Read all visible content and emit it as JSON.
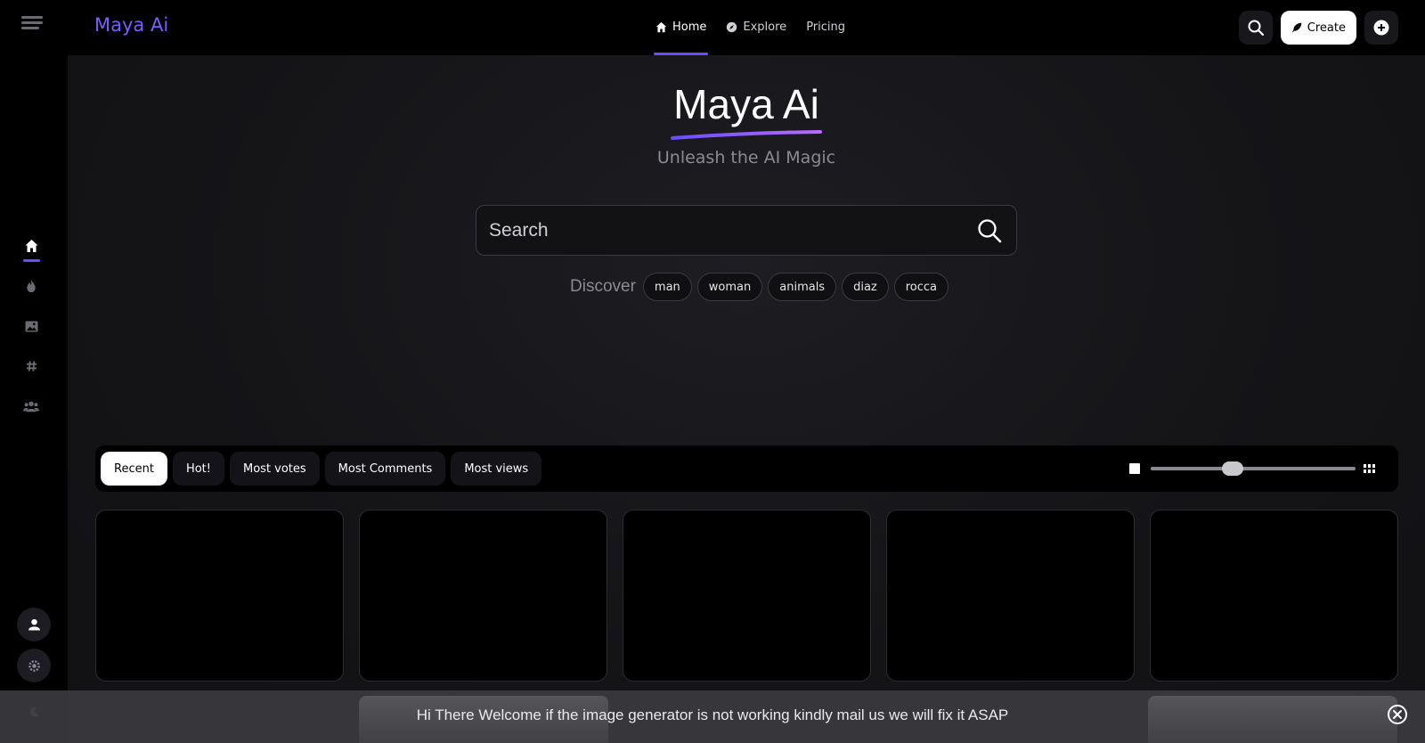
{
  "brand": "Maya Ai",
  "nav": [
    {
      "label": "Home",
      "icon": "home-icon",
      "active": true
    },
    {
      "label": "Explore",
      "icon": "compass-icon",
      "active": false
    },
    {
      "label": "Pricing",
      "icon": "",
      "active": false
    }
  ],
  "top_actions": {
    "search_icon": "search-icon",
    "create_label": "Create",
    "create_icon": "feather-icon",
    "add_icon": "plus-circle-icon"
  },
  "sidebar": {
    "items": [
      {
        "icon": "home-icon",
        "active": true
      },
      {
        "icon": "flame-icon",
        "active": false
      },
      {
        "icon": "image-icon",
        "active": false
      },
      {
        "icon": "hashtag-icon",
        "active": false
      },
      {
        "icon": "users-icon",
        "active": false
      }
    ],
    "bottom": [
      {
        "icon": "user-icon"
      },
      {
        "icon": "gear-icon"
      },
      {
        "icon": "moon-icon"
      }
    ]
  },
  "hero": {
    "title": "Maya Ai",
    "subtitle": "Unleash the AI Magic"
  },
  "search": {
    "placeholder": "Search",
    "value": ""
  },
  "discover": {
    "label": "Discover",
    "tags": [
      "man",
      "woman",
      "animals",
      "diaz",
      "rocca"
    ]
  },
  "filters": {
    "tabs": [
      {
        "label": "Recent",
        "active": true
      },
      {
        "label": "Hot!",
        "active": false
      },
      {
        "label": "Most votes",
        "active": false
      },
      {
        "label": "Most Comments",
        "active": false
      },
      {
        "label": "Most views",
        "active": false
      }
    ],
    "grid_size_slider": 0.4
  },
  "cards_count": 5,
  "banner": {
    "message": "Hi There Welcome if the image generator is not working kindly mail us we will fix it ASAP",
    "close_icon": "close-circle-icon"
  },
  "colors": {
    "accent": "#6b4dff",
    "brand": "#7b5cff",
    "background": "#000000"
  }
}
